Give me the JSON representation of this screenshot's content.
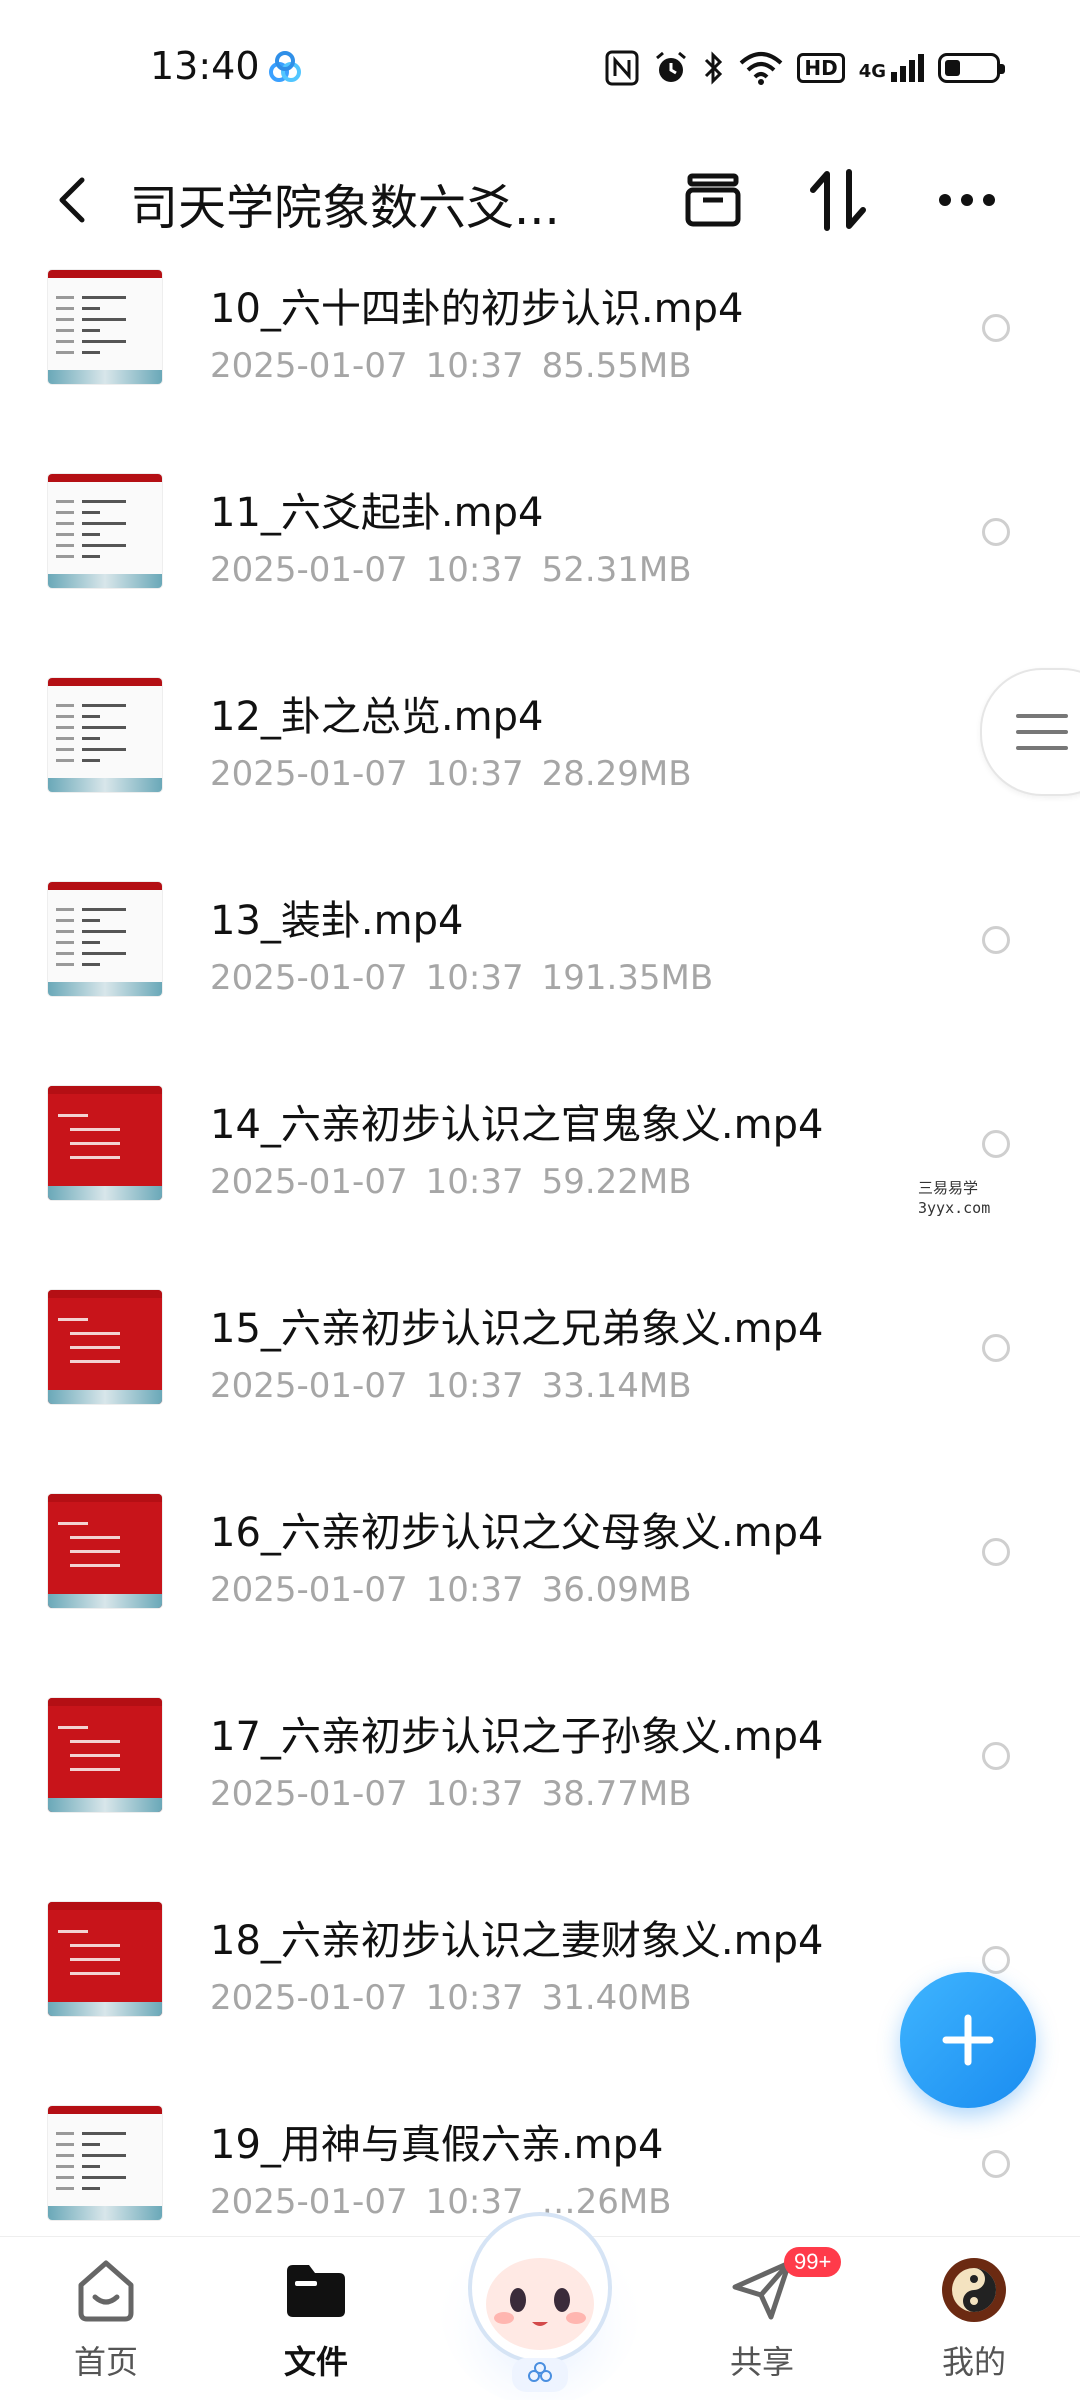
{
  "status_bar": {
    "time": "13:40",
    "network": "4G"
  },
  "header": {
    "title": "司天学院象数六爻..."
  },
  "files": [
    {
      "name": "10_六十四卦的初步认识.mp4",
      "date": "2025-01-07",
      "time": "10:37",
      "size": "85.55MB",
      "thumb": "white"
    },
    {
      "name": "11_六爻起卦.mp4",
      "date": "2025-01-07",
      "time": "10:37",
      "size": "52.31MB",
      "thumb": "white"
    },
    {
      "name": "12_卦之总览.mp4",
      "date": "2025-01-07",
      "time": "10:37",
      "size": "28.29MB",
      "thumb": "white"
    },
    {
      "name": "13_装卦.mp4",
      "date": "2025-01-07",
      "time": "10:37",
      "size": "191.35MB",
      "thumb": "white"
    },
    {
      "name": "14_六亲初步认识之官鬼象义.mp4",
      "date": "2025-01-07",
      "time": "10:37",
      "size": "59.22MB",
      "thumb": "red"
    },
    {
      "name": "15_六亲初步认识之兄弟象义.mp4",
      "date": "2025-01-07",
      "time": "10:37",
      "size": "33.14MB",
      "thumb": "red"
    },
    {
      "name": "16_六亲初步认识之父母象义.mp4",
      "date": "2025-01-07",
      "time": "10:37",
      "size": "36.09MB",
      "thumb": "red"
    },
    {
      "name": "17_六亲初步认识之子孙象义.mp4",
      "date": "2025-01-07",
      "time": "10:37",
      "size": "38.77MB",
      "thumb": "red"
    },
    {
      "name": "18_六亲初步认识之妻财象义.mp4",
      "date": "2025-01-07",
      "time": "10:37",
      "size": "31.40MB",
      "thumb": "red"
    },
    {
      "name": "19_用神与真假六亲.mp4",
      "date": "2025-01-07",
      "time": "10:37",
      "size": "…26MB",
      "thumb": "white"
    }
  ],
  "watermark": {
    "line1": "三易易学",
    "line2": "3yyx.com"
  },
  "nav": {
    "home": "首页",
    "files": "文件",
    "share": "共享",
    "share_badge": "99+",
    "mine": "我的"
  },
  "colors": {
    "accent": "#1a8cf0",
    "thumb_red": "#c8141a",
    "badge": "#ff3b4a"
  }
}
